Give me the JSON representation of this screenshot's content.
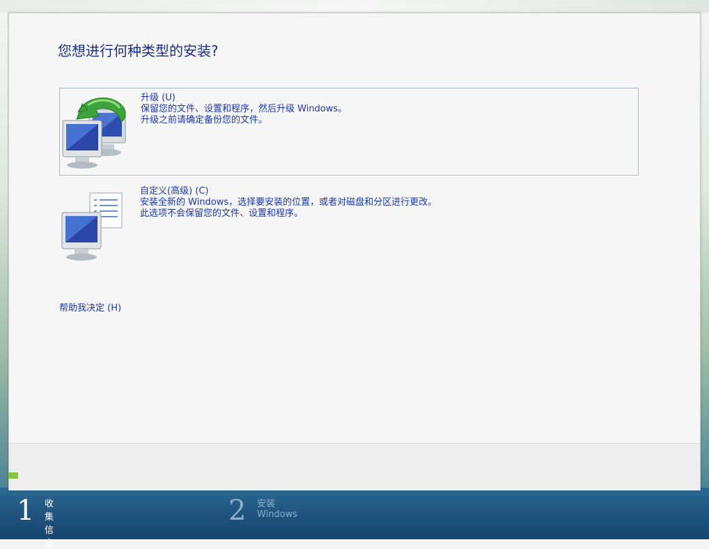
{
  "dialog": {
    "title": "您想进行何种类型的安装?"
  },
  "options": {
    "upgrade": {
      "title": "升级 (U)",
      "desc_line1": "保留您的文件、设置和程序，然后升级 Windows。",
      "desc_line2": "升级之前请确定备份您的文件。",
      "icon": "upgrade-computers-icon"
    },
    "custom": {
      "title": "自定义(高级) (C)",
      "desc_line1": "安装全新的 Windows，选择要安装的位置，或者对磁盘和分区进行更改。",
      "desc_line2": "此选项不会保留您的文件、设置和程序。",
      "icon": "custom-install-computer-icon"
    }
  },
  "help_link": "帮助我决定 (H)",
  "steps": [
    {
      "number": "1",
      "label": "收集信息",
      "active": true
    },
    {
      "number": "2",
      "label": "安装 Windows",
      "active": false
    }
  ],
  "colors": {
    "link_blue": "#1b36b5",
    "title_blue": "#1c2f86",
    "taskbar": "#1f527c",
    "accent_green": "#86c53a"
  }
}
